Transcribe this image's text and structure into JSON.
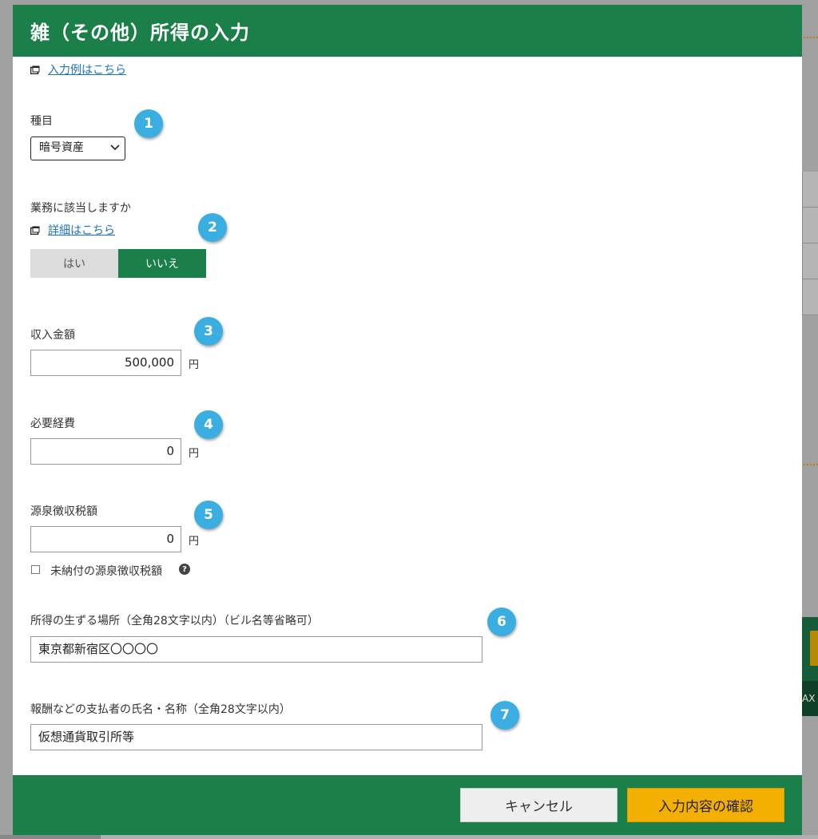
{
  "modal": {
    "title": "雑（その他）所得の入力"
  },
  "links": {
    "example": "入力例はこちら",
    "details": "詳細はこちら"
  },
  "fields": {
    "category": {
      "label": "種目",
      "selected": "暗号資産"
    },
    "business": {
      "label": "業務に該当しますか",
      "options": [
        "はい",
        "いいえ"
      ],
      "selected": "いいえ"
    },
    "income": {
      "label": "収入金額",
      "value": "500,000",
      "unit": "円"
    },
    "expenses": {
      "label": "必要経費",
      "value": "0",
      "unit": "円"
    },
    "withholding": {
      "label": "源泉徴収税額",
      "value": "0",
      "unit": "円",
      "unpaid_checkbox_label": "未納付の源泉徴収税額"
    },
    "location": {
      "label": "所得の生ずる場所（全角28文字以内）（ビル名等省略可）",
      "value": "東京都新宿区〇〇〇〇"
    },
    "payer": {
      "label": "報酬などの支払者の氏名・名称（全角28文字以内）",
      "value": "仮想通貨取引所等"
    }
  },
  "badges": [
    "1",
    "2",
    "3",
    "4",
    "5",
    "6",
    "7"
  ],
  "footer": {
    "cancel_label": "キャンセル",
    "confirm_label": "入力内容の確認"
  },
  "background": {
    "partial_text": "AX"
  },
  "colors": {
    "header_green": "#1a7f49",
    "confirm_yellow": "#f3b000",
    "badge_blue": "#3aaee0",
    "link_blue": "#1a73c4"
  },
  "icons": {
    "window": "window-icon",
    "dropdown": "chevron-down-icon",
    "help": "question-icon"
  }
}
